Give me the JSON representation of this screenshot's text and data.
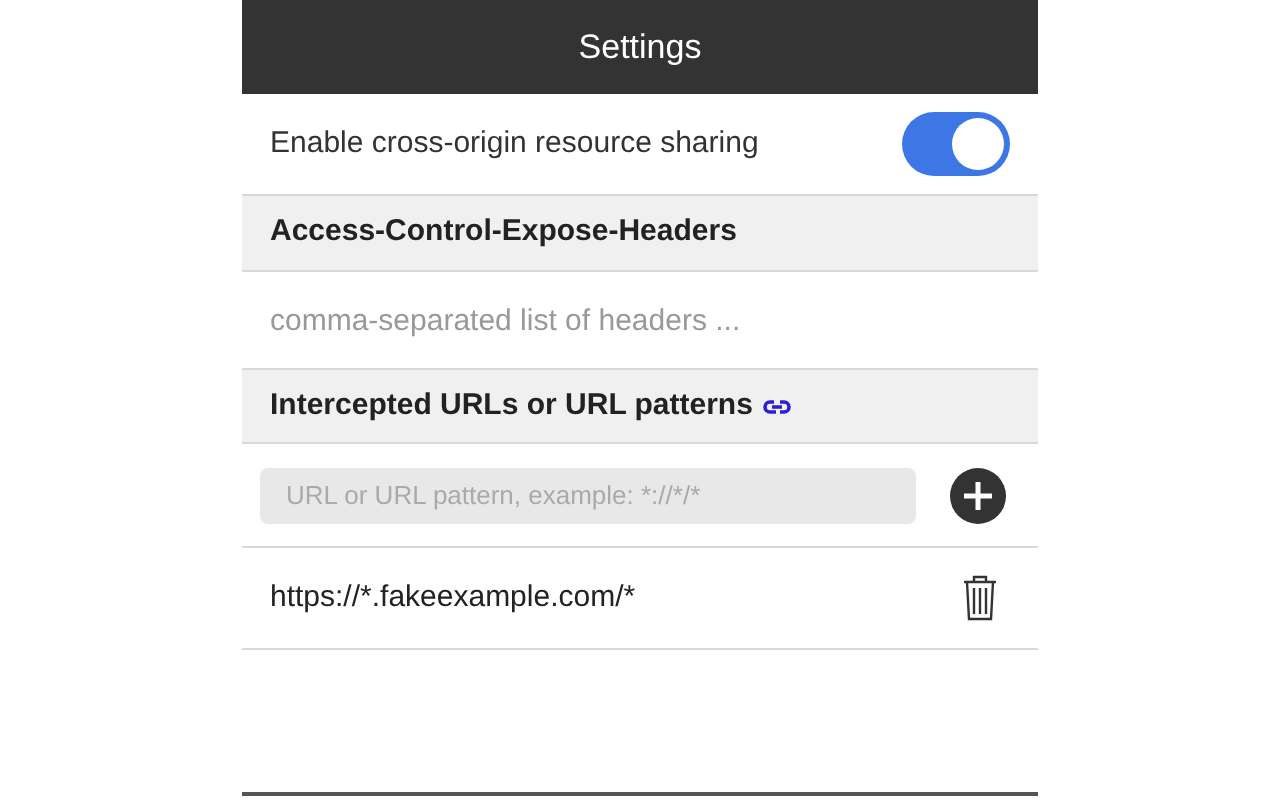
{
  "header": {
    "title": "Settings"
  },
  "cors": {
    "label": "Enable cross-origin resource sharing",
    "on": true
  },
  "expose_headers": {
    "heading": "Access-Control-Expose-Headers",
    "placeholder": "comma-separated list of headers ..."
  },
  "intercepted": {
    "heading": "Intercepted URLs or URL patterns",
    "placeholder": "URL or URL pattern, example: *://*/*",
    "urls": [
      "https://*.fakeexample.com/*"
    ]
  }
}
